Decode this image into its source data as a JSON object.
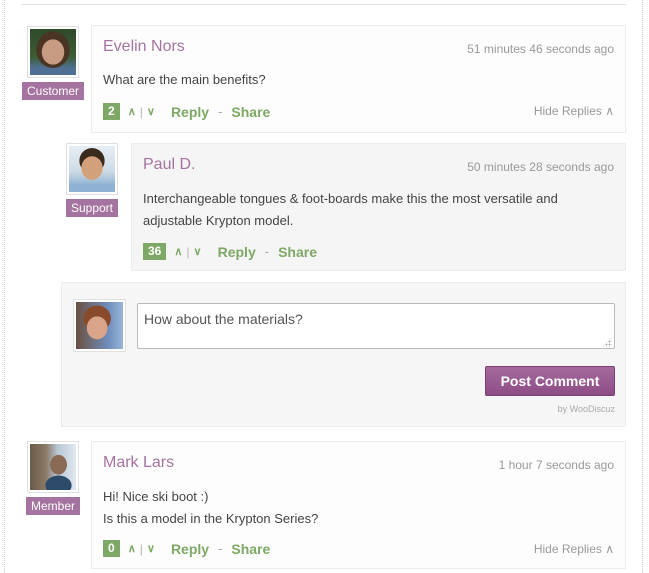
{
  "colors": {
    "accent_purple": "#a4739f",
    "vote_green": "#7ea865",
    "muted": "#999999",
    "button_purple": "#99598f"
  },
  "comments": [
    {
      "author": "Evelin Nors",
      "role": "Customer",
      "time": "51 minutes 46 seconds ago",
      "text_lines": [
        "What are the main benefits?"
      ],
      "votes": "2",
      "vote_up_icon": "∧",
      "vote_sep": "|",
      "vote_down_icon": "∨",
      "reply_label": "Reply",
      "dash": "-",
      "share_label": "Share",
      "hide_replies_label": "Hide Replies ∧"
    },
    {
      "author": "Paul D.",
      "role": "Support",
      "time": "50 minutes 28 seconds ago",
      "text_lines": [
        "Interchangeable tongues & foot-boards make this the most versatile and",
        "adjustable Krypton model."
      ],
      "votes": "36",
      "vote_up_icon": "∧",
      "vote_sep": "|",
      "vote_down_icon": "∨",
      "reply_label": "Reply",
      "dash": "-",
      "share_label": "Share"
    },
    {
      "author": "Mark Lars",
      "role": "Member",
      "time": "1 hour 7 seconds ago",
      "text_lines": [
        "Hi! Nice ski boot :)",
        "Is this a model in the Krypton Series?"
      ],
      "votes": "0",
      "vote_up_icon": "∧",
      "vote_sep": "|",
      "vote_down_icon": "∨",
      "reply_label": "Reply",
      "dash": "-",
      "share_label": "Share",
      "hide_replies_label": "Hide Replies ∧"
    }
  ],
  "reply_form": {
    "input_value": "How about the materials?",
    "post_button_label": "Post Comment",
    "powered_by": "by WooDiscuz"
  }
}
